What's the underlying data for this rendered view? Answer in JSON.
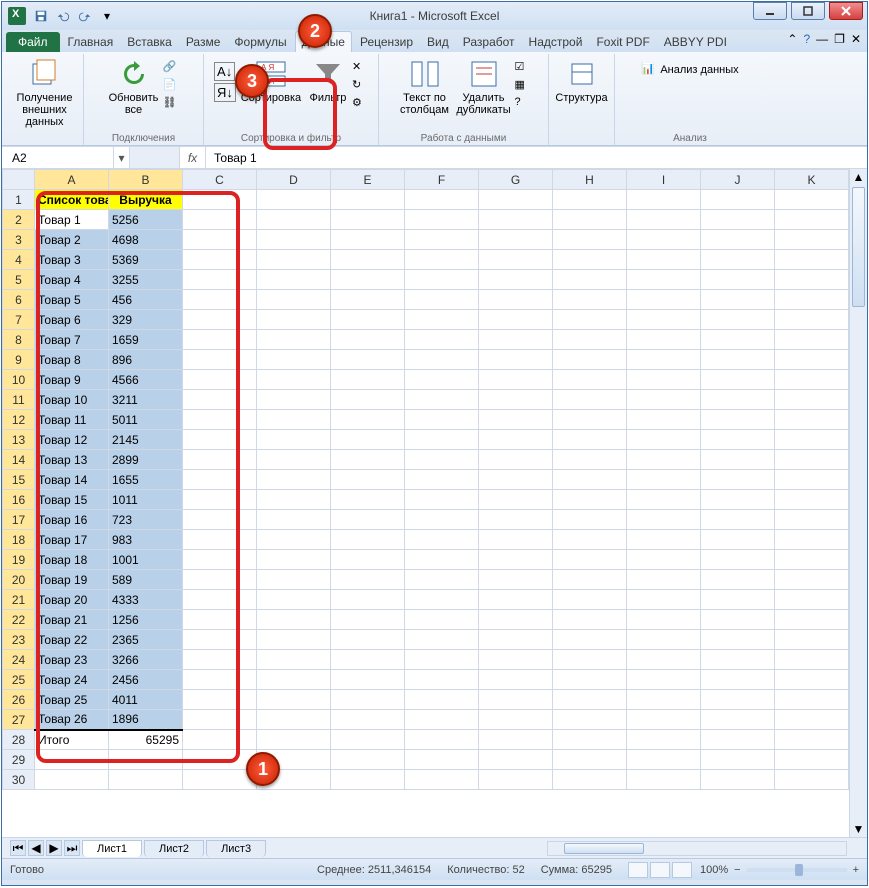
{
  "title": "Книга1  -  Microsoft Excel",
  "tabs": {
    "file": "Файл",
    "list": [
      "Главная",
      "Вставка",
      "Разме",
      "Формулы",
      "Данные",
      "Рецензир",
      "Вид",
      "Разработ",
      "Надстрой",
      "Foxit PDF",
      "ABBYY PDI"
    ],
    "active_index": 4
  },
  "ribbon": {
    "g1": {
      "btn": "Получение\nвнешних данных",
      "label": ""
    },
    "g2": {
      "btn": "Обновить\nвсе",
      "props": "Свойства",
      "edit": "Изменить связи",
      "conn": "Подключения",
      "label": "Подключения"
    },
    "g3": {
      "sort_asc": "А↓Я",
      "sort_desc": "Я↓А",
      "sort": "Сортировка",
      "filter": "Фильтр",
      "clear": "Очистить",
      "reapply": "Повторить",
      "adv": "Дополнительно",
      "label": "Сортировка и фильтр"
    },
    "g4": {
      "ttc": "Текст по\nстолбцам",
      "dup": "Удалить\nдубликаты",
      "val": "Проверка данных",
      "cons": "Консолидация",
      "what": "Анализ \"что если\"",
      "label": "Работа с данными"
    },
    "g5": {
      "struct": "Структура",
      "label": ""
    },
    "g6": {
      "da": "Анализ данных",
      "label": "Анализ"
    }
  },
  "name_box": "A2",
  "fx_label": "fx",
  "formula_bar": "Товар 1",
  "columns": [
    "A",
    "B",
    "C",
    "D",
    "E",
    "F",
    "G",
    "H",
    "I",
    "J",
    "K"
  ],
  "header": {
    "a": "Список товаров",
    "b": "Выручка"
  },
  "rows": [
    {
      "n": 1,
      "a": "Список товаров",
      "b": "Выручка",
      "hdr": true
    },
    {
      "n": 2,
      "a": "Товар 1",
      "b": 5256,
      "sel": true,
      "active": true
    },
    {
      "n": 3,
      "a": "Товар 2",
      "b": 4698,
      "sel": true
    },
    {
      "n": 4,
      "a": "Товар 3",
      "b": 5369,
      "sel": true
    },
    {
      "n": 5,
      "a": "Товар 4",
      "b": 3255,
      "sel": true
    },
    {
      "n": 6,
      "a": "Товар 5",
      "b": 456,
      "sel": true
    },
    {
      "n": 7,
      "a": "Товар 6",
      "b": 329,
      "sel": true
    },
    {
      "n": 8,
      "a": "Товар 7",
      "b": 1659,
      "sel": true
    },
    {
      "n": 9,
      "a": "Товар 8",
      "b": 896,
      "sel": true
    },
    {
      "n": 10,
      "a": "Товар 9",
      "b": 4566,
      "sel": true
    },
    {
      "n": 11,
      "a": "Товар 10",
      "b": 3211,
      "sel": true
    },
    {
      "n": 12,
      "a": "Товар 11",
      "b": 5011,
      "sel": true
    },
    {
      "n": 13,
      "a": "Товар 12",
      "b": 2145,
      "sel": true
    },
    {
      "n": 14,
      "a": "Товар 13",
      "b": 2899,
      "sel": true
    },
    {
      "n": 15,
      "a": "Товар 14",
      "b": 1655,
      "sel": true
    },
    {
      "n": 16,
      "a": "Товар 15",
      "b": 1011,
      "sel": true
    },
    {
      "n": 17,
      "a": "Товар 16",
      "b": 723,
      "sel": true
    },
    {
      "n": 18,
      "a": "Товар 17",
      "b": 983,
      "sel": true
    },
    {
      "n": 19,
      "a": "Товар 18",
      "b": 1001,
      "sel": true
    },
    {
      "n": 20,
      "a": "Товар 19",
      "b": 589,
      "sel": true
    },
    {
      "n": 21,
      "a": "Товар 20",
      "b": 4333,
      "sel": true
    },
    {
      "n": 22,
      "a": "Товар 21",
      "b": 1256,
      "sel": true
    },
    {
      "n": 23,
      "a": "Товар 22",
      "b": 2365,
      "sel": true
    },
    {
      "n": 24,
      "a": "Товар 23",
      "b": 3266,
      "sel": true
    },
    {
      "n": 25,
      "a": "Товар 24",
      "b": 2456,
      "sel": true
    },
    {
      "n": 26,
      "a": "Товар 25",
      "b": 4011,
      "sel": true
    },
    {
      "n": 27,
      "a": "Товар 26",
      "b": 1896,
      "sel": true
    },
    {
      "n": 28,
      "a": "Итого",
      "b": 65295,
      "total": true
    },
    {
      "n": 29,
      "a": "",
      "b": ""
    },
    {
      "n": 30,
      "a": "",
      "b": ""
    }
  ],
  "sheet_tabs": [
    "Лист1",
    "Лист2",
    "Лист3"
  ],
  "status": {
    "ready": "Готово",
    "avg_label": "Среднее:",
    "avg": "2511,346154",
    "count_label": "Количество:",
    "count": "52",
    "sum_label": "Сумма:",
    "sum": "65295",
    "zoom": "100%"
  },
  "callouts": {
    "c1": "1",
    "c2": "2",
    "c3": "3"
  }
}
